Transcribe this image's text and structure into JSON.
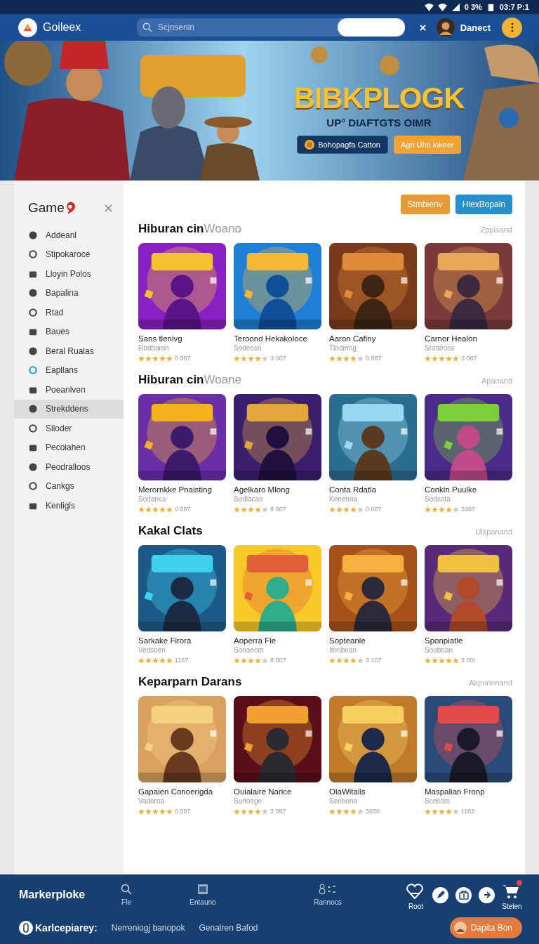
{
  "status_bar": {
    "battery": "0 3%",
    "time": "03:7 P:1"
  },
  "header": {
    "brand": "Goileex",
    "search": {
      "placeholder": "Scjnsenin"
    },
    "user": "Danect"
  },
  "banner": {
    "title": "BIBKPLOGK",
    "subtitle": "UP° DIAFTGTS OIMR",
    "buttons": [
      {
        "label": "Bohopagfa Catton",
        "kind": "secondary"
      },
      {
        "label": "Agn Uho lokeer",
        "kind": "primary"
      }
    ]
  },
  "sidebar": {
    "title": "Game",
    "items": [
      {
        "label": "Addeanl",
        "selected": false
      },
      {
        "label": "Stipokaroce",
        "selected": false
      },
      {
        "label": "Lloyin Polos",
        "selected": false
      },
      {
        "label": "Bapalina",
        "selected": false
      },
      {
        "label": "Rtad",
        "selected": false
      },
      {
        "label": "Baues",
        "selected": false
      },
      {
        "label": "Beral Rualas",
        "selected": false
      },
      {
        "label": "Eapllans",
        "selected": false
      },
      {
        "label": "Poeanlven",
        "selected": false
      },
      {
        "label": "Strekddens",
        "selected": true
      },
      {
        "label": "Siloder",
        "selected": false
      },
      {
        "label": "Pecoiahen",
        "selected": false
      },
      {
        "label": "Peodralloos",
        "selected": false
      },
      {
        "label": "Cankgs",
        "selected": false
      },
      {
        "label": "Kenligls",
        "selected": false
      }
    ]
  },
  "actions": [
    {
      "label": "Stmbienv",
      "kind": "orange"
    },
    {
      "label": "HlexBopain",
      "kind": "blue"
    }
  ],
  "sections": [
    {
      "title": "Hiburan cin",
      "title_muted": "Woano",
      "link": "Zppisand",
      "games": [
        {
          "name": "Sans tlenivg",
          "subtitle": "Rodbaron",
          "stars": 5,
          "rating": "0 087"
        },
        {
          "name": "Teroond Hekakoloce",
          "subtitle": "Sodeosn",
          "stars": 4,
          "rating": "3 007"
        },
        {
          "name": "Aaron Cafiny",
          "subtitle": "Tlodemg",
          "stars": 4,
          "rating": "0 087"
        },
        {
          "name": "Carnor Healon",
          "subtitle": "Srodeoss",
          "stars": 5,
          "rating": "3 087"
        }
      ]
    },
    {
      "title": "Hiburan cin",
      "title_muted": "Woane",
      "link": "Apanand",
      "games": [
        {
          "name": "Merornkke Pnaisting",
          "subtitle": "Sodanca",
          "stars": 5,
          "rating": "0 097"
        },
        {
          "name": "Agelkaro Mlong",
          "subtitle": "Sodlacas",
          "stars": 4,
          "rating": "8 007"
        },
        {
          "name": "Conta Rdatla",
          "subtitle": "Kenenoa",
          "stars": 4,
          "rating": "0 007"
        },
        {
          "name": "Conkin Puulke",
          "subtitle": "Sodsota",
          "stars": 4,
          "rating": "3407"
        }
      ]
    },
    {
      "title": "Kakal Clats",
      "link": "Ulspanand",
      "games": [
        {
          "name": "Sarkake Firora",
          "subtitle": "Vedsoen",
          "stars": 5,
          "rating": "1167"
        },
        {
          "name": "Aoperra Fie",
          "subtitle": "Sooaeom",
          "stars": 4,
          "rating": "8 007"
        },
        {
          "name": "Sopteanle",
          "subtitle": "Itenbean",
          "stars": 4,
          "rating": "3 107"
        },
        {
          "name": "Sponpiatle",
          "subtitle": "Sooboan",
          "stars": 5,
          "rating": "3 00r"
        }
      ]
    },
    {
      "title": "Keparparn Darans",
      "link": "Akpunenand",
      "games": [
        {
          "name": "Gapaien Conoerigda",
          "subtitle": "Vaderna",
          "stars": 5,
          "rating": "0 097"
        },
        {
          "name": "Ouialaire Narice",
          "subtitle": "Surioage",
          "stars": 4,
          "rating": "3 097"
        },
        {
          "name": "OlaWitalls",
          "subtitle": "Senbona",
          "stars": 4,
          "rating": "3650"
        },
        {
          "name": "Maspalian Fronp",
          "subtitle": "Scdsom",
          "stars": 4,
          "rating": "1182"
        }
      ]
    }
  ],
  "footer": {
    "brand": "Markerploke",
    "nav": [
      {
        "label": "Fle",
        "kind": "search"
      },
      {
        "label": "Entauno",
        "kind": "window"
      },
      {
        "label": "Rannocs",
        "kind": "people"
      }
    ],
    "quick": [
      {
        "label": "Root",
        "kind": "heart"
      },
      {
        "kind": "pen"
      },
      {
        "kind": "bag"
      },
      {
        "kind": "arrow"
      },
      {
        "label": "Stelen",
        "kind": "cart",
        "badge": true
      }
    ],
    "account": "Karlcepiarey:",
    "links": [
      "Nerreniogj banopok",
      "Genalren Bafod"
    ],
    "cta": "Dapita Bon"
  }
}
